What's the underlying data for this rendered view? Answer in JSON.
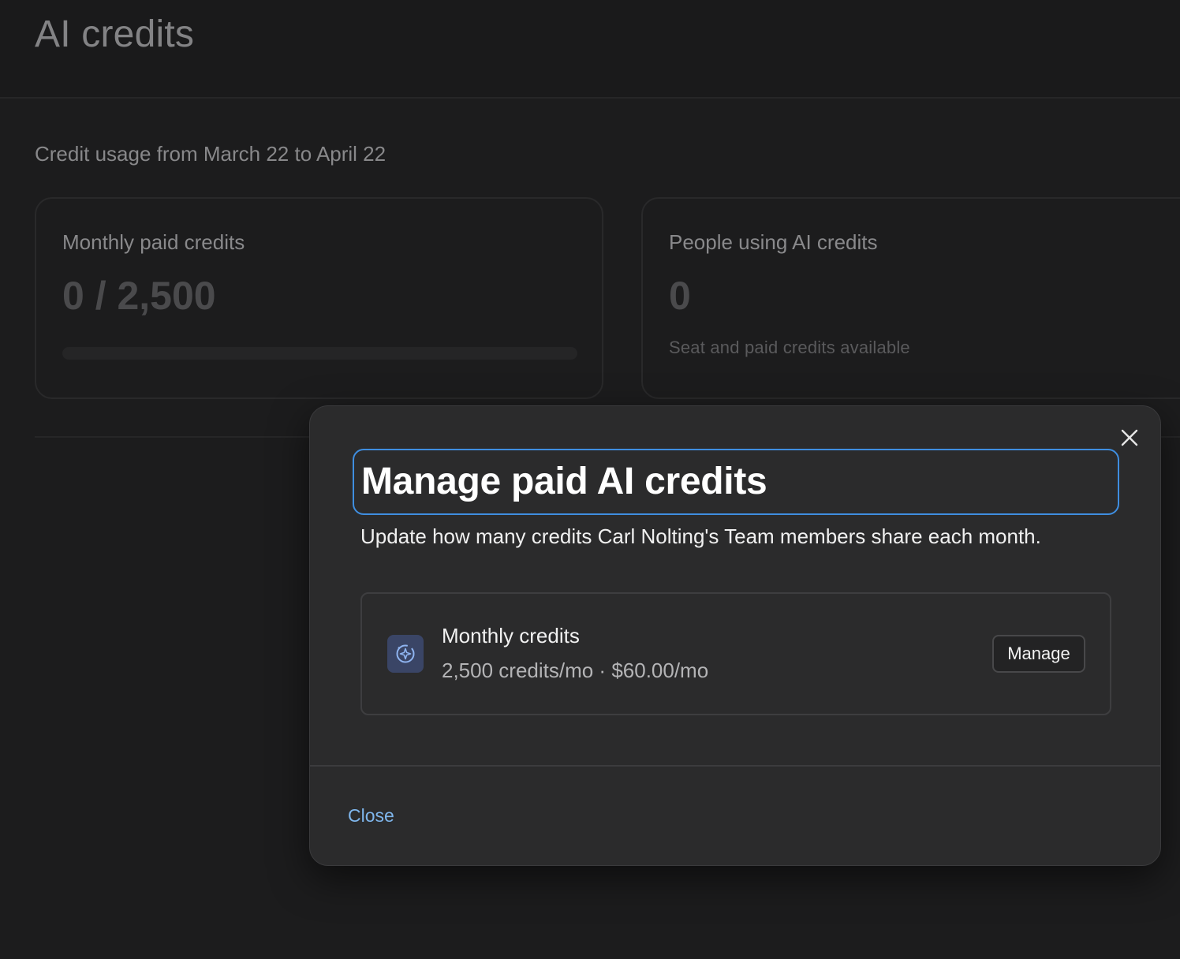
{
  "page": {
    "title": "AI credits",
    "section_label": "Credit usage from March 22 to April 22"
  },
  "cards": {
    "monthly": {
      "label": "Monthly paid credits",
      "value": "0 / 2,500",
      "progress_fraction": 0
    },
    "people": {
      "label": "People using AI credits",
      "value": "0",
      "subtext": "Seat and paid credits available"
    }
  },
  "modal": {
    "title": "Manage paid AI credits",
    "description": "Update how many credits Carl Nolting's Team members share each month.",
    "credit_item": {
      "icon": "ai-sparkle-icon",
      "name": "Monthly credits",
      "detail": "2,500 credits/mo · $60.00/mo",
      "manage_label": "Manage"
    },
    "close_label": "Close",
    "close_icon": "close-icon"
  },
  "colors": {
    "background": "#1c1c1d",
    "modal_background": "#2b2b2c",
    "focus_ring": "#3f8ee0",
    "link": "#7fb6ec",
    "icon_tile": "#3a4566"
  }
}
